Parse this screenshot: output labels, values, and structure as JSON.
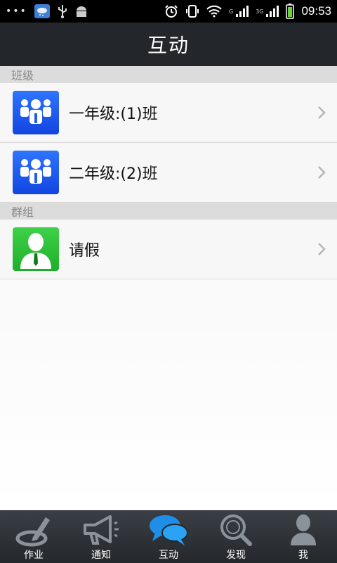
{
  "status_bar": {
    "dots": "•••",
    "net_label_1": "G",
    "net_label_2": "3G",
    "time": "09:53"
  },
  "header": {
    "title": "互动"
  },
  "sections": [
    {
      "title": "班级",
      "items": [
        {
          "label": "一年级:(1)班",
          "icon": "group-icon"
        },
        {
          "label": "二年级:(2)班",
          "icon": "group-icon"
        }
      ]
    },
    {
      "title": "群组",
      "items": [
        {
          "label": "请假",
          "icon": "person-icon"
        }
      ]
    }
  ],
  "bottom_nav": [
    {
      "label": "作业",
      "icon": "pencil-icon",
      "active": false
    },
    {
      "label": "通知",
      "icon": "megaphone-icon",
      "active": false
    },
    {
      "label": "互动",
      "icon": "chat-bubbles-icon",
      "active": true
    },
    {
      "label": "发现",
      "icon": "magnifier-icon",
      "active": false
    },
    {
      "label": "我",
      "icon": "user-icon",
      "active": false
    }
  ],
  "colors": {
    "header_bg": "#23272b",
    "nav_bg": "#2e3338",
    "group_icon_bg": "#1f5cf0",
    "person_icon_bg": "#30c23b",
    "active_nav": "#1f8ee6"
  }
}
